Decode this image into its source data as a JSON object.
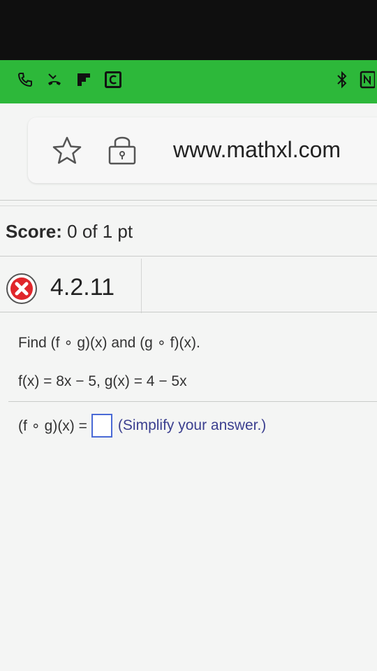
{
  "status_bar": {
    "left_icons": [
      "phone-icon",
      "missed-call-icon",
      "flipboard-icon",
      "c-box-icon"
    ],
    "right_icons": [
      "bluetooth-icon",
      "nfc-icon"
    ],
    "color": "#2db83a"
  },
  "browser": {
    "url": "www.mathxl.com"
  },
  "score": {
    "label": "Score:",
    "value": "0 of 1 pt"
  },
  "question": {
    "id": "4.2.11",
    "status_icon": "incorrect-x-icon",
    "prompt": "Find (f ∘ g)(x) and (g ∘ f)(x).",
    "functions": "f(x) = 8x − 5,  g(x) = 4 − 5x",
    "answer_label": "(f ∘ g)(x) =",
    "answer_value": "",
    "answer_hint": "(Simplify your answer.)"
  },
  "colors": {
    "error_red": "#e0262b",
    "input_border": "#4a6ad6"
  }
}
